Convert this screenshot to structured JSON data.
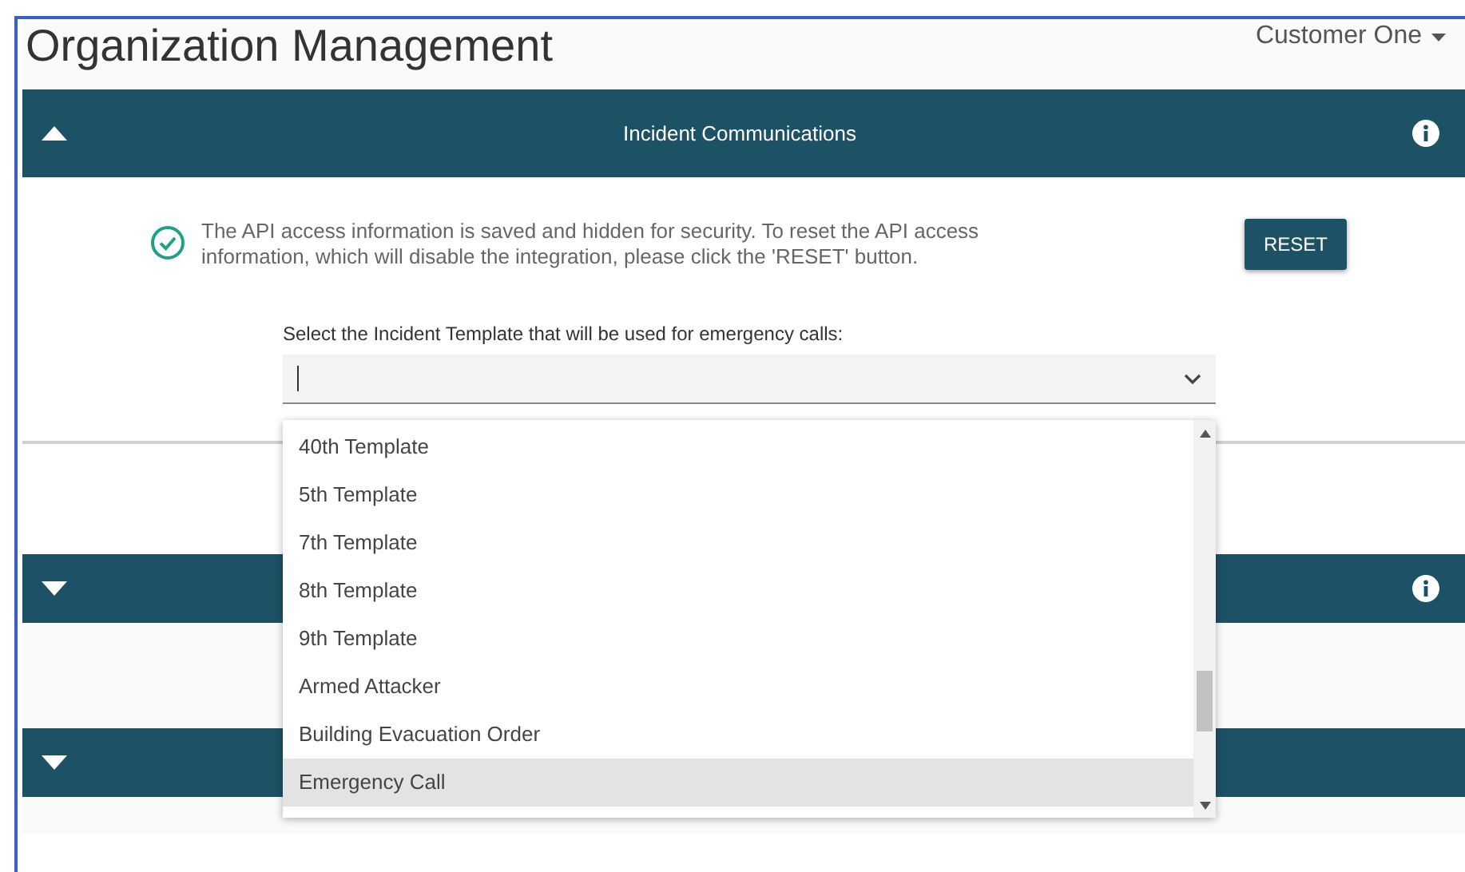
{
  "page_title": "Organization Management",
  "account_menu": {
    "label": "Customer One"
  },
  "panels": [
    {
      "title": "Incident Communications",
      "expanded": true,
      "info": true,
      "message": "The API access information is saved and hidden for security. To reset the API access information, which will disable the integration, please click the 'RESET' button.",
      "button": "RESET",
      "select": {
        "label": "Select the Incident Template that will be used for emergency calls:",
        "focused": true,
        "options": [
          {
            "label": "40th Template",
            "highlighted": false
          },
          {
            "label": "5th Template",
            "highlighted": false
          },
          {
            "label": "7th Template",
            "highlighted": false
          },
          {
            "label": "8th Template",
            "highlighted": false
          },
          {
            "label": "9th Template",
            "highlighted": false
          },
          {
            "label": "Armed Attacker",
            "highlighted": false
          },
          {
            "label": "Building Evacuation Order",
            "highlighted": false
          },
          {
            "label": "Emergency Call",
            "highlighted": true
          }
        ]
      }
    },
    {
      "expanded": false,
      "info": true
    },
    {
      "expanded": false,
      "info": false
    }
  ]
}
